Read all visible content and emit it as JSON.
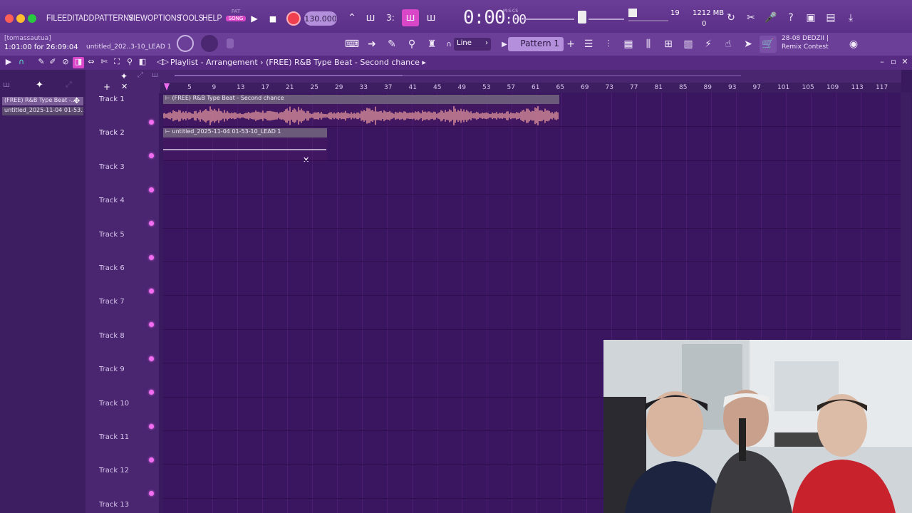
{
  "menu": {
    "items": [
      "FILE",
      "EDIT",
      "ADD",
      "PATTERNS",
      "VIEW",
      "OPTIONS",
      "TOOLS",
      "HELP"
    ]
  },
  "transport": {
    "pat_label": "PAT",
    "song_label": "SONG",
    "tempo": "130.000",
    "time": "0:00",
    "time_sub": ":00",
    "time_unit": "M:S:CS",
    "voices": "19",
    "memory": "1212 MB",
    "cpu": "0"
  },
  "toolbar2": {
    "hint_user": "[tomassautua]",
    "hint_time": "1:01:00 for 26:09:04",
    "hint_file": "untitled_202..3-10_LEAD 1",
    "snap": "Line",
    "pattern": "Pattern 1",
    "news_line1": "28-08  DEDZII |",
    "news_line2": "Remix Contest"
  },
  "playlist": {
    "title": "Playlist - Arrangement",
    "separator": "›",
    "arrangement_name": "(FREE) R&B Type Beat - Second chance",
    "picker": [
      "(FREE) R&B Type Beat -...",
      "untitled_2025-11-04 01-53..."
    ],
    "bars": [
      "5",
      "9",
      "13",
      "17",
      "21",
      "25",
      "29",
      "33",
      "37",
      "41",
      "45",
      "49",
      "53",
      "57",
      "61",
      "65",
      "69",
      "73",
      "77",
      "81",
      "85",
      "89",
      "93",
      "97",
      "101",
      "105",
      "109",
      "113",
      "117"
    ],
    "tracks": [
      "Track 1",
      "Track 2",
      "Track 3",
      "Track 4",
      "Track 5",
      "Track 6",
      "Track 7",
      "Track 8",
      "Track 9",
      "Track 10",
      "Track 11",
      "Track 12",
      "Track 13"
    ],
    "clips": [
      {
        "name": "(FREE) R&B Type Beat - Second chance"
      },
      {
        "name": "untitled_2025-11-04 01-53-10_LEAD 1"
      }
    ]
  },
  "colors": {
    "accent": "#d946c8",
    "waveform": "#f0a0a0",
    "background": "#3a1560"
  }
}
